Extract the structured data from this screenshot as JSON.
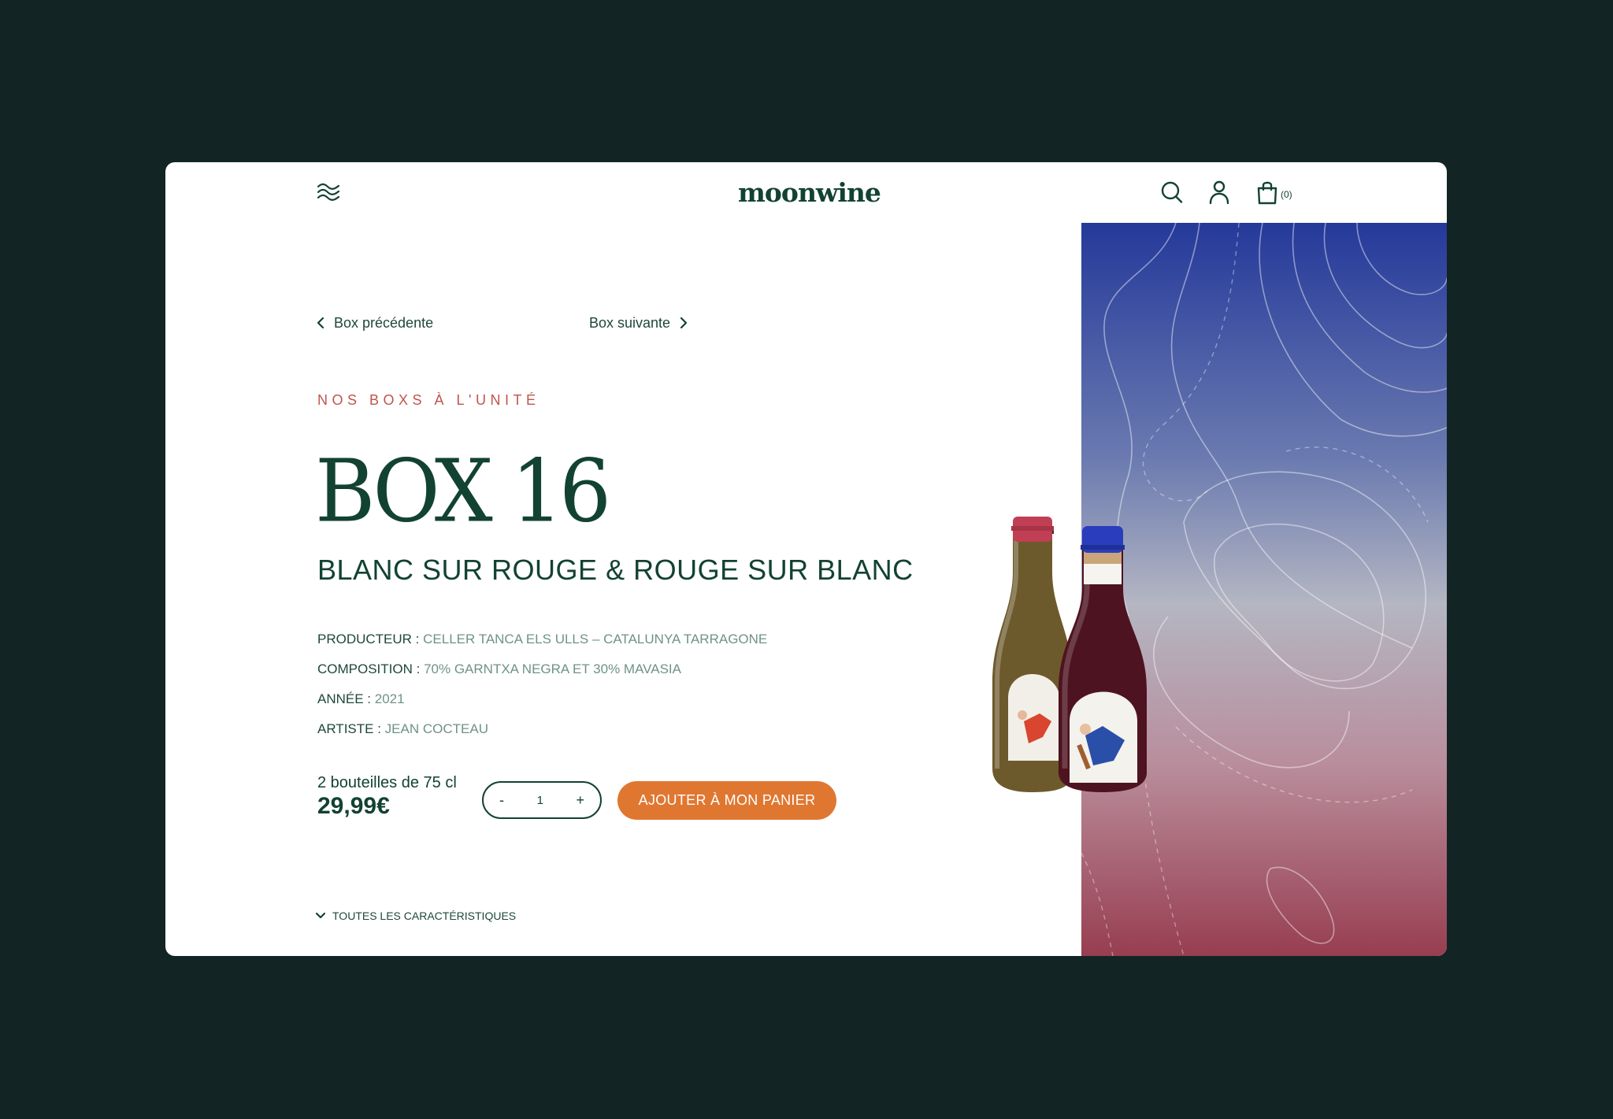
{
  "header": {
    "logo": "moonwine",
    "cart_count": "(0)"
  },
  "nav": {
    "prev_label": "Box précédente",
    "next_label": "Box suivante"
  },
  "product": {
    "eyebrow": "NOS BOXS À L'UNITÉ",
    "title": "BOX 16",
    "subtitle": "BLANC SUR ROUGE & ROUGE SUR BLANC",
    "specs": [
      {
        "label": "PRODUCTEUR :",
        "value": "CELLER TANCA ELS ULLS – CATALUNYA TARRAGONE"
      },
      {
        "label": "COMPOSITION :",
        "value": "70% GARNTXA NEGRA ET 30% MAVASIA"
      },
      {
        "label": "ANNÉE :",
        "value": "2021"
      },
      {
        "label": "ARTISTE :",
        "value": "JEAN COCTEAU"
      }
    ],
    "bottles_label": "2 bouteilles de 75 cl",
    "price": "29,99€"
  },
  "purchase": {
    "minus": "-",
    "quantity": "1",
    "plus": "+",
    "add_to_cart": "AJOUTER À MON PANIER"
  },
  "features_toggle": "TOUTES LES CARACTÉRISTIQUES",
  "colors": {
    "brand_green": "#124232",
    "accent_orange": "#e07731",
    "eyebrow_red": "#c0554c",
    "page_bg": "#122424"
  }
}
